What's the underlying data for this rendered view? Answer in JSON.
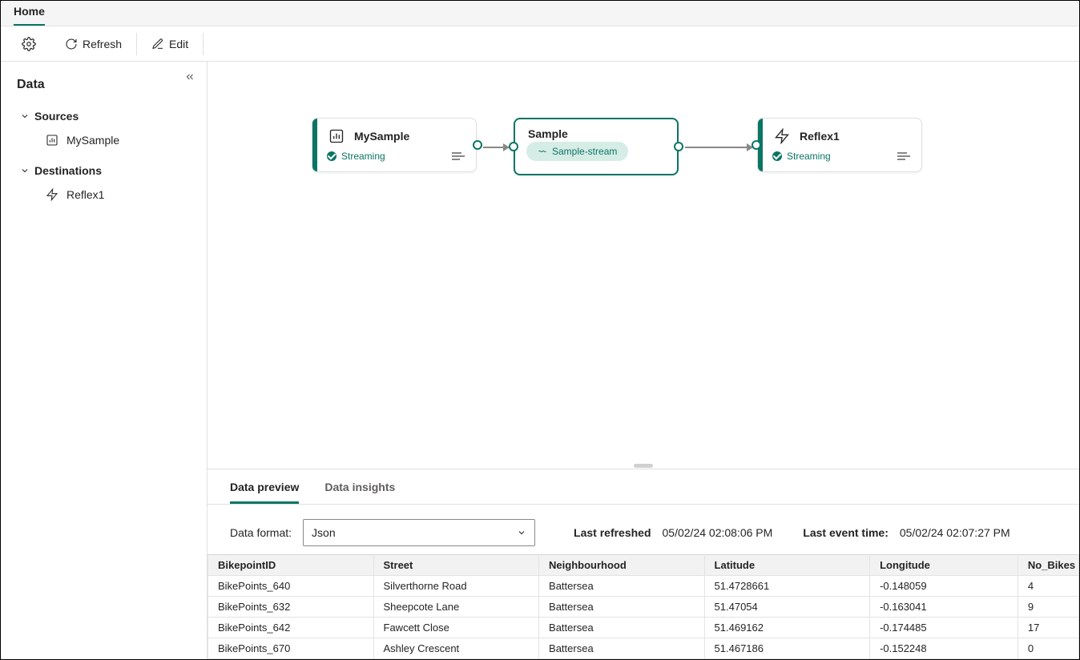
{
  "accent_color": "#0b7564",
  "ribbon": {
    "tabs": [
      "Home"
    ],
    "active_tab": "Home"
  },
  "toolbar": {
    "refresh_label": "Refresh",
    "edit_label": "Edit"
  },
  "sidebar": {
    "title": "Data",
    "sections": [
      {
        "label": "Sources",
        "items": [
          {
            "name": "MySample",
            "icon": "barchart-icon"
          }
        ]
      },
      {
        "label": "Destinations",
        "items": [
          {
            "name": "Reflex1",
            "icon": "lightning-icon"
          }
        ]
      }
    ]
  },
  "graph": {
    "nodes": [
      {
        "id": "source",
        "title": "MySample",
        "status": "Streaming",
        "icon": "barchart-icon"
      },
      {
        "id": "stream",
        "title": "Sample",
        "chip_label": "Sample-stream",
        "selected": true
      },
      {
        "id": "dest",
        "title": "Reflex1",
        "status": "Streaming",
        "icon": "lightning-icon"
      }
    ]
  },
  "preview": {
    "tabs": {
      "preview": "Data preview",
      "insights": "Data insights"
    },
    "format_label": "Data format:",
    "format_value": "Json",
    "last_refreshed_label": "Last refreshed",
    "last_refreshed_value": "05/02/24 02:08:06 PM",
    "last_event_label": "Last event time:",
    "last_event_value": "05/02/24 02:07:27 PM",
    "columns": [
      "BikepointID",
      "Street",
      "Neighbourhood",
      "Latitude",
      "Longitude",
      "No_Bikes"
    ],
    "rows": [
      [
        "BikePoints_640",
        "Silverthorne Road",
        "Battersea",
        "51.4728661",
        "-0.148059",
        "4"
      ],
      [
        "BikePoints_632",
        "Sheepcote Lane",
        "Battersea",
        "51.47054",
        "-0.163041",
        "9"
      ],
      [
        "BikePoints_642",
        "Fawcett Close",
        "Battersea",
        "51.469162",
        "-0.174485",
        "17"
      ],
      [
        "BikePoints_670",
        "Ashley Crescent",
        "Battersea",
        "51.467186",
        "-0.152248",
        "0"
      ]
    ]
  }
}
